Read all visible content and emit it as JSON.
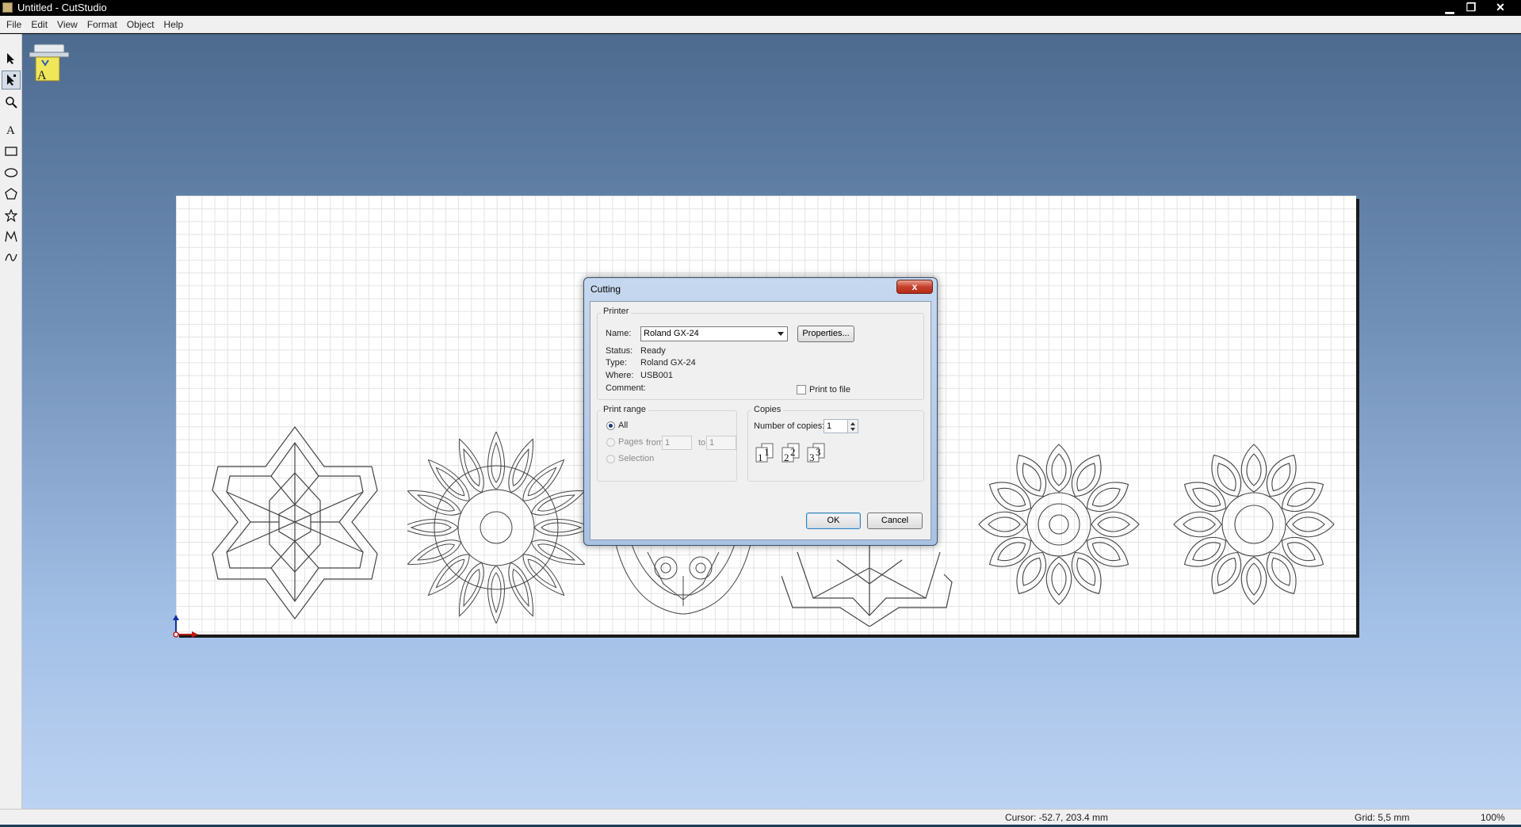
{
  "window": {
    "title": "Untitled - CutStudio",
    "minimize": "▁",
    "maximize": "❐",
    "close": "✕"
  },
  "menu": [
    "File",
    "Edit",
    "View",
    "Format",
    "Object",
    "Help"
  ],
  "tools": [
    "select-arrow-icon",
    "node-edit-arrow-icon",
    "zoom-icon",
    "text-tool-icon",
    "rectangle-icon",
    "ellipse-icon",
    "polygon-icon",
    "star-icon",
    "polyline-icon",
    "curve-icon"
  ],
  "tray": {
    "label": "A"
  },
  "status": {
    "cursor": "Cursor: -52.7, 203.4 mm",
    "grid": "Grid: 5,5 mm",
    "zoom": "100%"
  },
  "dialog": {
    "title": "Cutting",
    "close": "x",
    "printer": {
      "group_label": "Printer",
      "name_label": "Name:",
      "name_value": "Roland GX-24",
      "properties_button": "Properties...",
      "status_label": "Status:",
      "status_value": "Ready",
      "type_label": "Type:",
      "type_value": "Roland GX-24",
      "where_label": "Where:",
      "where_value": "USB001",
      "comment_label": "Comment:",
      "print_to_file": "Print to file"
    },
    "range": {
      "group_label": "Print range",
      "all": "All",
      "pages": "Pages",
      "from_label": "from:",
      "from_value": "1",
      "to_label": "to:",
      "to_value": "1",
      "selection": "Selection"
    },
    "copies": {
      "group_label": "Copies",
      "number_label": "Number of copies:",
      "number_value": "1",
      "collate_digits": [
        "1",
        "1",
        "2",
        "2",
        "3",
        "3"
      ]
    },
    "ok": "OK",
    "cancel": "Cancel"
  }
}
